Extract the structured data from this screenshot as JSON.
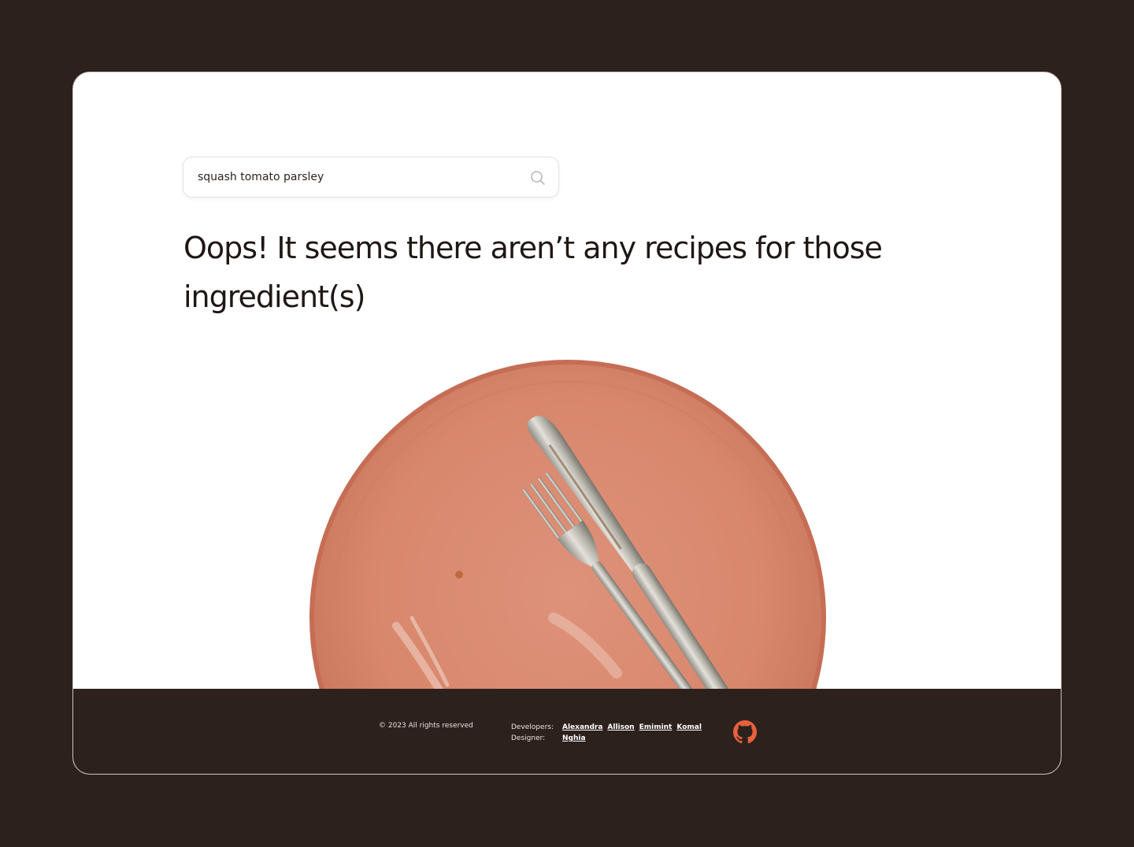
{
  "search": {
    "value": "squash tomato parsley",
    "icon": "search-icon"
  },
  "message": {
    "headline": "Oops! It seems there aren’t any recipes for those ingredient(s)"
  },
  "footer": {
    "copyright": "© 2023 All rights reserved",
    "developers_label": "Developers:",
    "designer_label": "Designer:",
    "developers": [
      {
        "name": "Alexandra"
      },
      {
        "name": "Allison"
      },
      {
        "name": "Emimint"
      },
      {
        "name": "Komal"
      }
    ],
    "designer": {
      "name": "Nghia"
    },
    "github_icon": "github-icon"
  },
  "colors": {
    "background": "#2d211e",
    "card": "#ffffff",
    "plate": "#d98a70",
    "accent": "#e8603c"
  }
}
